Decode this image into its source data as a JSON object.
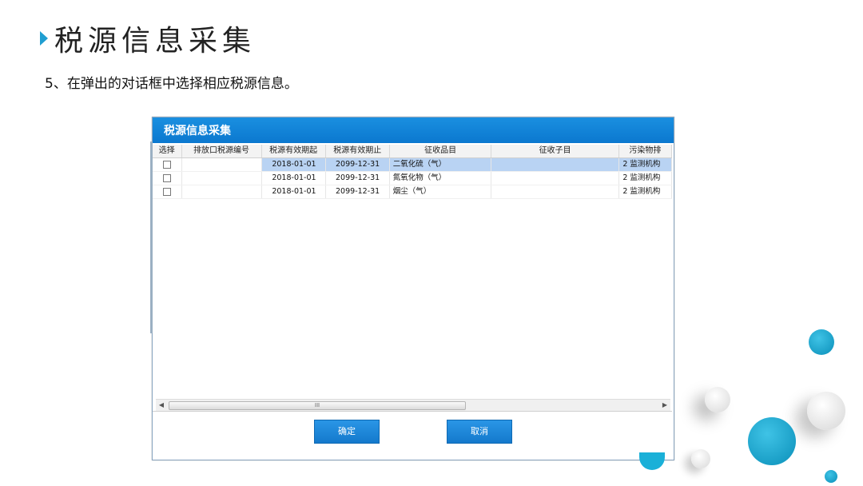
{
  "slide": {
    "title": "税源信息采集",
    "step": "5、在弹出的对话框中选择相应税源信息。"
  },
  "dialog": {
    "title": "税源信息采集",
    "columns": [
      "选择",
      "排放口税源编号",
      "税源有效期起",
      "税源有效期止",
      "征收品目",
      "征收子目",
      "污染物排"
    ],
    "rows": [
      {
        "start": "2018-01-01",
        "end": "2099-12-31",
        "item": "二氧化硫（气）",
        "sub": "",
        "pollutant": "2 监测机构"
      },
      {
        "start": "2018-01-01",
        "end": "2099-12-31",
        "item": "氮氧化物（气）",
        "sub": "",
        "pollutant": "2 监测机构"
      },
      {
        "start": "2018-01-01",
        "end": "2099-12-31",
        "item": "烟尘（气）",
        "sub": "",
        "pollutant": "2 监测机构"
      }
    ],
    "scroll_thumb_label": "III",
    "ok_label": "确定",
    "cancel_label": "取消"
  },
  "colors": {
    "accent": "#1f9ed1",
    "titlebar": "#0b78cf",
    "selected_row": "#b9d3f3"
  }
}
